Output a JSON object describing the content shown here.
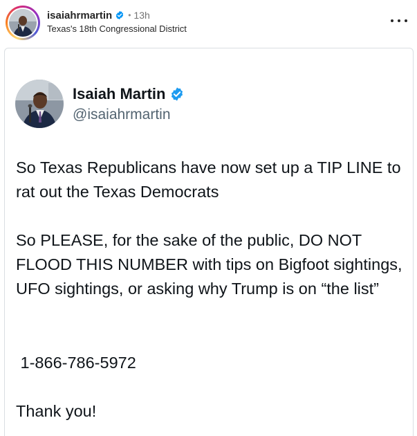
{
  "post": {
    "username": "isaiahrmartin",
    "separator": "•",
    "time_ago": "13h",
    "subtitle": "Texas's 18th Congressional District",
    "more_icon": "more-horizontal-icon"
  },
  "tweet": {
    "display_name": "Isaiah Martin",
    "handle": "@isaiahrmartin",
    "verified_color": "#1d9bf0",
    "paragraphs": [
      "So Texas Republicans have now set up a TIP LINE to rat out the Texas Democrats",
      "So PLEASE, for the sake of the public, DO NOT FLOOD THIS NUMBER with tips on Bigfoot sightings, UFO sightings, or asking why Trump is on “the list”",
      " 1-866-786-5972",
      "Thank you!"
    ]
  },
  "colors": {
    "instagram_verified": "#0095f6",
    "twitter_verified": "#1d9bf0",
    "text_primary": "#0f1419",
    "text_secondary": "#536471"
  }
}
